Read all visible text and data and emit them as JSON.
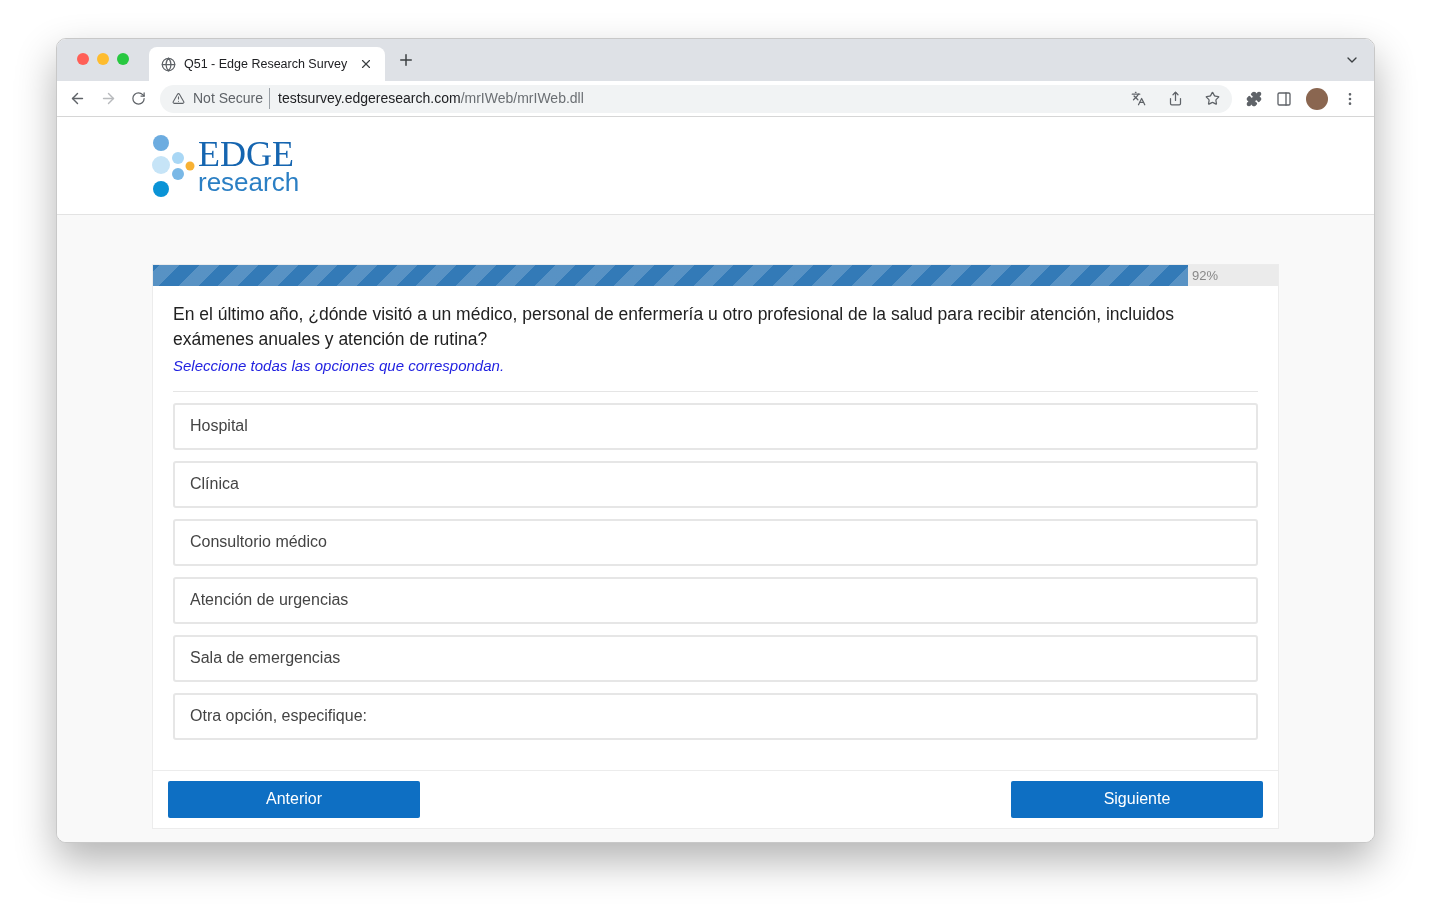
{
  "browser": {
    "tab_title": "Q51 - Edge Research Survey",
    "security": "Not Secure",
    "url_host": "testsurvey.edgeresearch.com",
    "url_path": "/mrIWeb/mrIWeb.dll"
  },
  "logo": {
    "line_1": "EDGE",
    "line_2": "research"
  },
  "progress": {
    "level": 0.92,
    "label": "92%"
  },
  "question": {
    "text": "En el último año, ¿dónde visitó a un médico, personal de enfermería u otro profesional de la salud para recibir atención, incluidos exámenes anuales y atención de rutina?",
    "instruction": "Seleccione todas las opciones que correspondan."
  },
  "options": [
    {
      "label": "Hospital"
    },
    {
      "label": "Clínica"
    },
    {
      "label": "Consultorio médico"
    },
    {
      "label": "Atención de urgencias"
    },
    {
      "label": "Sala de emergencias"
    },
    {
      "label": "Otra opción, especifique:"
    }
  ],
  "buttons": {
    "back": "Anterior",
    "next": "Siguiente"
  }
}
